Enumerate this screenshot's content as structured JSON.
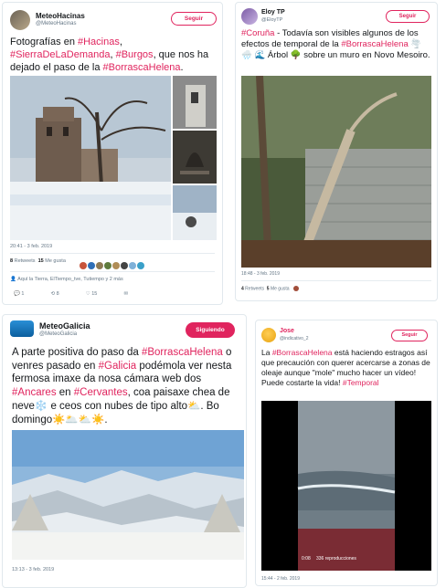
{
  "tweets": [
    {
      "name": "MeteoHacinas",
      "handle": "@MeteoHacinas",
      "follow": "Seguir",
      "text": [
        {
          "t": "Fotografías en "
        },
        {
          "t": "#Hacinas",
          "h": true
        },
        {
          "t": ", "
        },
        {
          "t": "#SierraDeLaDemanda",
          "h": true
        },
        {
          "t": ", "
        },
        {
          "t": "#Burgos",
          "h": true
        },
        {
          "t": ", que nos ha dejado el paso de la "
        },
        {
          "t": "#BorrascaHelena",
          "h": true
        },
        {
          "t": "."
        }
      ],
      "time": "20:41 - 3 feb. 2019",
      "retweets_count": "8",
      "retweets_label": "Retweets",
      "likes_count": "15",
      "likes_label": "Me gusta",
      "location": "Aquí la Tierra, ElTiempo_tve, Tutiempo y 2 más",
      "reply_count": "1",
      "rt_count": "8",
      "like_count": "15"
    },
    {
      "name": "Eloy TP",
      "handle": "@EloyTP",
      "follow": "Seguir",
      "text": [
        {
          "t": "#Coruña",
          "h": true
        },
        {
          "t": " - Todavía son visibles algunos de los efectos de temporal de la "
        },
        {
          "t": "#BorrascaHelena",
          "h": true
        },
        {
          "t": " 🌪️ 🌧️ 🌊 Árbol 🌳 sobre un muro en Novo Mesoiro."
        }
      ],
      "time": "18:48 - 3 feb. 2019",
      "retweets_count": "4",
      "retweets_label": "Retweets",
      "likes_count": "5",
      "likes_label": "Me gusta"
    },
    {
      "name": "MeteoGalicia",
      "handle": "@MeteoGalicia",
      "follow": "Siguiendo",
      "text": [
        {
          "t": "A parte positiva do paso da "
        },
        {
          "t": "#BorrascaHelena",
          "h": true
        },
        {
          "t": " o venres pasado en "
        },
        {
          "t": "#Galicia",
          "h": true
        },
        {
          "t": " podémola ver nesta fermosa imaxe da nosa cámara web dos "
        },
        {
          "t": "#Ancares",
          "h": true
        },
        {
          "t": " en "
        },
        {
          "t": "#Cervantes",
          "h": true
        },
        {
          "t": ", coa paisaxe chea de neve❄️ e ceos con nubes de tipo alto⛅. Bo domingo☀️🌥️⛅☀️."
        }
      ],
      "time": "13:13 - 3 feb. 2019"
    },
    {
      "name": "Jose",
      "handle": "@indicativo_2",
      "follow": "Seguir",
      "text": [
        {
          "t": "La "
        },
        {
          "t": "#BorrascaHelena",
          "h": true
        },
        {
          "t": " está haciendo estragos así que precaución con querer acercarse a zonas de oleaje aunque \"mole\" mucho hacer un vídeo! Puede costarte la vida! "
        },
        {
          "t": "#Temporal",
          "h": true
        }
      ],
      "time": "15:44 - 2 feb. 2019",
      "video_duration": "0:08",
      "video_views": "336 reproducciones"
    }
  ],
  "colors": {
    "accent": "#e0245e",
    "hashtag": "#e0245e",
    "muted": "#657786",
    "border": "#e1e8ed"
  },
  "icons": [
    "reply-icon",
    "retweet-icon",
    "heart-icon",
    "location-icon",
    "play-icon"
  ]
}
